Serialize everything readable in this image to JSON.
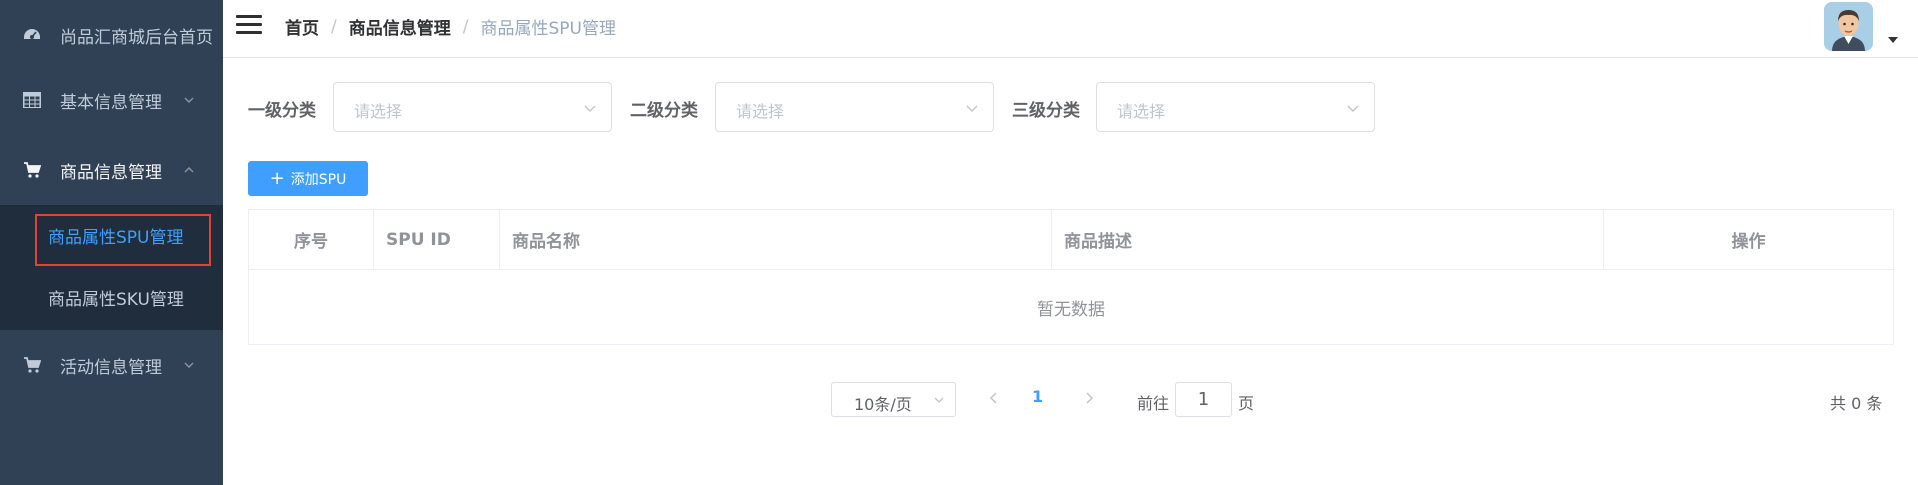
{
  "sidebar": {
    "items": [
      {
        "label": "尚品汇商城后台首页",
        "icon": "dashboard-icon"
      },
      {
        "label": "基本信息管理",
        "icon": "table-icon"
      },
      {
        "label": "商品信息管理",
        "icon": "cart-icon"
      },
      {
        "label": "活动信息管理",
        "icon": "cart-icon"
      }
    ],
    "submenu": [
      {
        "label": "商品属性SPU管理",
        "active": true
      },
      {
        "label": "商品属性SKU管理",
        "active": false
      }
    ]
  },
  "header": {
    "breadcrumb": [
      "首页",
      "商品信息管理",
      "商品属性SPU管理"
    ],
    "separator": "/"
  },
  "filters": [
    {
      "label": "一级分类",
      "placeholder": "请选择"
    },
    {
      "label": "二级分类",
      "placeholder": "请选择"
    },
    {
      "label": "三级分类",
      "placeholder": "请选择"
    }
  ],
  "toolbar": {
    "add_label": "添加SPU",
    "add_icon": "+"
  },
  "table": {
    "columns": [
      "序号",
      "SPU ID",
      "商品名称",
      "商品描述",
      "操作"
    ],
    "empty_text": "暂无数据"
  },
  "pagination": {
    "page_size": "10条/页",
    "current_page": "1",
    "goto_label": "前往",
    "goto_value": "1",
    "page_unit": "页",
    "total": "共 0 条"
  },
  "colors": {
    "sidebar_bg": "#304156",
    "submenu_bg": "#1f2d3d",
    "primary": "#409eff",
    "highlight_border": "#e8412f"
  }
}
